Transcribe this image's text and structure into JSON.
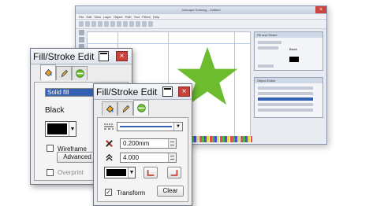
{
  "background_app": {
    "title": "Inkscape Drawing - Untitled",
    "menu": [
      "File",
      "Edit",
      "View",
      "Layer",
      "Object",
      "Path",
      "Text",
      "Filters",
      "Help"
    ],
    "panel_top_title": "Fill and Stroke",
    "panel_top_color": "Black",
    "panel_bottom_title": "Object Editor"
  },
  "star": {
    "fill_color": "#6dbb2e"
  },
  "dialog_back": {
    "title": "Fill/Stroke Edit",
    "fill_type": "Solid fill",
    "color_name": "Black",
    "wireframe_label": "Wireframe",
    "advanced_label": "Advanced",
    "overprint_label": "Overprint",
    "colors": {
      "selection": "#3561b5",
      "swatch": "#000000"
    }
  },
  "dialog_front": {
    "title": "Fill/Stroke Edit",
    "width_value": "0.200mm",
    "miter_value": "4.000",
    "transform_label": "Transform",
    "transform_checked": "✓",
    "clear_label": "Clear",
    "colors": {
      "line": "#3561b5",
      "swatch": "#000000",
      "cap_red": "#c0392b"
    }
  },
  "icons": {
    "close": "×",
    "dropdown": "▼",
    "check": "✓"
  }
}
